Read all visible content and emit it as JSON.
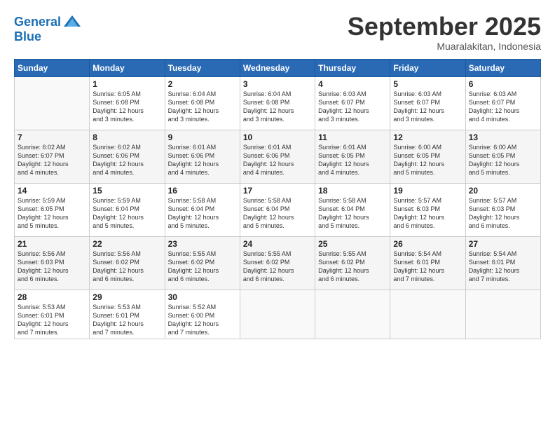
{
  "logo": {
    "line1": "General",
    "line2": "Blue"
  },
  "title": "September 2025",
  "subtitle": "Muaralakitan, Indonesia",
  "header_days": [
    "Sunday",
    "Monday",
    "Tuesday",
    "Wednesday",
    "Thursday",
    "Friday",
    "Saturday"
  ],
  "weeks": [
    [
      {
        "day": "",
        "info": ""
      },
      {
        "day": "1",
        "info": "Sunrise: 6:05 AM\nSunset: 6:08 PM\nDaylight: 12 hours\nand 3 minutes."
      },
      {
        "day": "2",
        "info": "Sunrise: 6:04 AM\nSunset: 6:08 PM\nDaylight: 12 hours\nand 3 minutes."
      },
      {
        "day": "3",
        "info": "Sunrise: 6:04 AM\nSunset: 6:08 PM\nDaylight: 12 hours\nand 3 minutes."
      },
      {
        "day": "4",
        "info": "Sunrise: 6:03 AM\nSunset: 6:07 PM\nDaylight: 12 hours\nand 3 minutes."
      },
      {
        "day": "5",
        "info": "Sunrise: 6:03 AM\nSunset: 6:07 PM\nDaylight: 12 hours\nand 3 minutes."
      },
      {
        "day": "6",
        "info": "Sunrise: 6:03 AM\nSunset: 6:07 PM\nDaylight: 12 hours\nand 4 minutes."
      }
    ],
    [
      {
        "day": "7",
        "info": "Sunrise: 6:02 AM\nSunset: 6:07 PM\nDaylight: 12 hours\nand 4 minutes."
      },
      {
        "day": "8",
        "info": "Sunrise: 6:02 AM\nSunset: 6:06 PM\nDaylight: 12 hours\nand 4 minutes."
      },
      {
        "day": "9",
        "info": "Sunrise: 6:01 AM\nSunset: 6:06 PM\nDaylight: 12 hours\nand 4 minutes."
      },
      {
        "day": "10",
        "info": "Sunrise: 6:01 AM\nSunset: 6:06 PM\nDaylight: 12 hours\nand 4 minutes."
      },
      {
        "day": "11",
        "info": "Sunrise: 6:01 AM\nSunset: 6:05 PM\nDaylight: 12 hours\nand 4 minutes."
      },
      {
        "day": "12",
        "info": "Sunrise: 6:00 AM\nSunset: 6:05 PM\nDaylight: 12 hours\nand 5 minutes."
      },
      {
        "day": "13",
        "info": "Sunrise: 6:00 AM\nSunset: 6:05 PM\nDaylight: 12 hours\nand 5 minutes."
      }
    ],
    [
      {
        "day": "14",
        "info": "Sunrise: 5:59 AM\nSunset: 6:05 PM\nDaylight: 12 hours\nand 5 minutes."
      },
      {
        "day": "15",
        "info": "Sunrise: 5:59 AM\nSunset: 6:04 PM\nDaylight: 12 hours\nand 5 minutes."
      },
      {
        "day": "16",
        "info": "Sunrise: 5:58 AM\nSunset: 6:04 PM\nDaylight: 12 hours\nand 5 minutes."
      },
      {
        "day": "17",
        "info": "Sunrise: 5:58 AM\nSunset: 6:04 PM\nDaylight: 12 hours\nand 5 minutes."
      },
      {
        "day": "18",
        "info": "Sunrise: 5:58 AM\nSunset: 6:04 PM\nDaylight: 12 hours\nand 5 minutes."
      },
      {
        "day": "19",
        "info": "Sunrise: 5:57 AM\nSunset: 6:03 PM\nDaylight: 12 hours\nand 6 minutes."
      },
      {
        "day": "20",
        "info": "Sunrise: 5:57 AM\nSunset: 6:03 PM\nDaylight: 12 hours\nand 6 minutes."
      }
    ],
    [
      {
        "day": "21",
        "info": "Sunrise: 5:56 AM\nSunset: 6:03 PM\nDaylight: 12 hours\nand 6 minutes."
      },
      {
        "day": "22",
        "info": "Sunrise: 5:56 AM\nSunset: 6:02 PM\nDaylight: 12 hours\nand 6 minutes."
      },
      {
        "day": "23",
        "info": "Sunrise: 5:55 AM\nSunset: 6:02 PM\nDaylight: 12 hours\nand 6 minutes."
      },
      {
        "day": "24",
        "info": "Sunrise: 5:55 AM\nSunset: 6:02 PM\nDaylight: 12 hours\nand 6 minutes."
      },
      {
        "day": "25",
        "info": "Sunrise: 5:55 AM\nSunset: 6:02 PM\nDaylight: 12 hours\nand 6 minutes."
      },
      {
        "day": "26",
        "info": "Sunrise: 5:54 AM\nSunset: 6:01 PM\nDaylight: 12 hours\nand 7 minutes."
      },
      {
        "day": "27",
        "info": "Sunrise: 5:54 AM\nSunset: 6:01 PM\nDaylight: 12 hours\nand 7 minutes."
      }
    ],
    [
      {
        "day": "28",
        "info": "Sunrise: 5:53 AM\nSunset: 6:01 PM\nDaylight: 12 hours\nand 7 minutes."
      },
      {
        "day": "29",
        "info": "Sunrise: 5:53 AM\nSunset: 6:01 PM\nDaylight: 12 hours\nand 7 minutes."
      },
      {
        "day": "30",
        "info": "Sunrise: 5:52 AM\nSunset: 6:00 PM\nDaylight: 12 hours\nand 7 minutes."
      },
      {
        "day": "",
        "info": ""
      },
      {
        "day": "",
        "info": ""
      },
      {
        "day": "",
        "info": ""
      },
      {
        "day": "",
        "info": ""
      }
    ]
  ]
}
